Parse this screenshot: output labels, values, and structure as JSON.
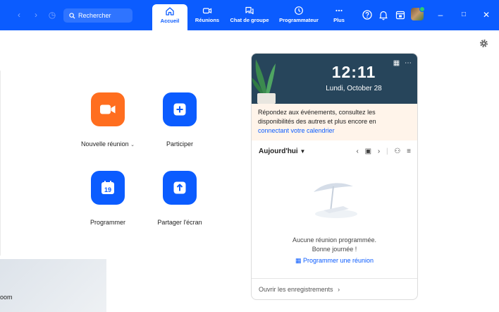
{
  "topbar": {
    "search_placeholder": "Rechercher",
    "tabs": [
      {
        "label": "Accueil",
        "icon": "home-icon",
        "active": true
      },
      {
        "label": "Réunions",
        "icon": "video-icon"
      },
      {
        "label": "Chat de groupe",
        "icon": "chat-icon"
      },
      {
        "label": "Programmateur",
        "icon": "clock-icon"
      },
      {
        "label": "Plus",
        "icon": "more-icon"
      }
    ],
    "icons": [
      "help-icon",
      "bell-icon",
      "calendar-icon",
      "avatar",
      "minimize-icon",
      "maximize-icon",
      "close-icon"
    ]
  },
  "actions": {
    "new_meeting": "Nouvelle réunion",
    "join": "Participer",
    "schedule": "Programmer",
    "schedule_day": "19",
    "share": "Partager l'écran"
  },
  "calendar": {
    "time": "12:11",
    "date": "Lundi, October 28",
    "notice_text": "Répondez aux événements, consultez les disponibilités des autres et plus encore en",
    "notice_link": "connectant votre calendrier",
    "day_selector": "Aujourd'hui",
    "empty_line1": "Aucune réunion programmée.",
    "empty_line2": "Bonne journée !",
    "schedule_link": "Programmer une réunion",
    "recordings_link": "Ouvrir les enregistrements"
  },
  "overlay": {
    "text": "oom"
  },
  "colors": {
    "brand_blue": "#0b5cff",
    "orange": "#ff6e1f",
    "calendar_header": "#27455b",
    "notice_bg": "#fff4ea"
  }
}
